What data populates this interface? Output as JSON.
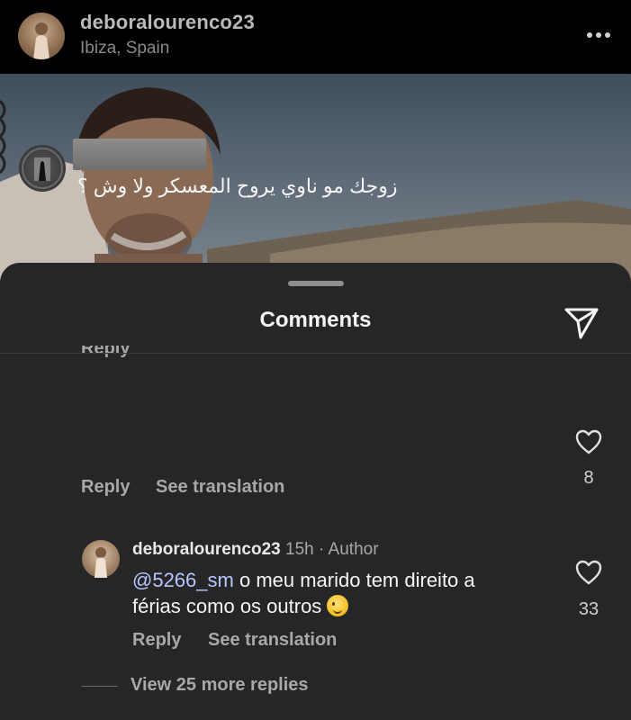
{
  "post": {
    "username": "deboralourenco23",
    "location": "Ibiza, Spain"
  },
  "sheet": {
    "title": "Comments",
    "cut_off_reply": "Reply"
  },
  "comments": [
    {
      "username": "",
      "text": "زوجك مو ناوي يروح المعسكر ولا وش ؟",
      "reply_label": "Reply",
      "translate_label": "See translation",
      "likes": "8"
    }
  ],
  "reply": {
    "username": "deboralourenco23",
    "time": "15h",
    "badge": "Author",
    "mention": "@5266_sm",
    "text": "o meu marido tem direito a férias como os outros",
    "emoji": "winking-face",
    "reply_label": "Reply",
    "translate_label": "See translation",
    "likes": "33"
  },
  "view_more_replies": "View 25 more replies",
  "icons": {
    "more": "more-horizontal-icon",
    "share": "paper-plane-icon",
    "like": "heart-outline-icon"
  },
  "colors": {
    "sheet_background": "#262626",
    "secondary_text": "#a8a8a8",
    "mention": "#b8c6ff"
  }
}
